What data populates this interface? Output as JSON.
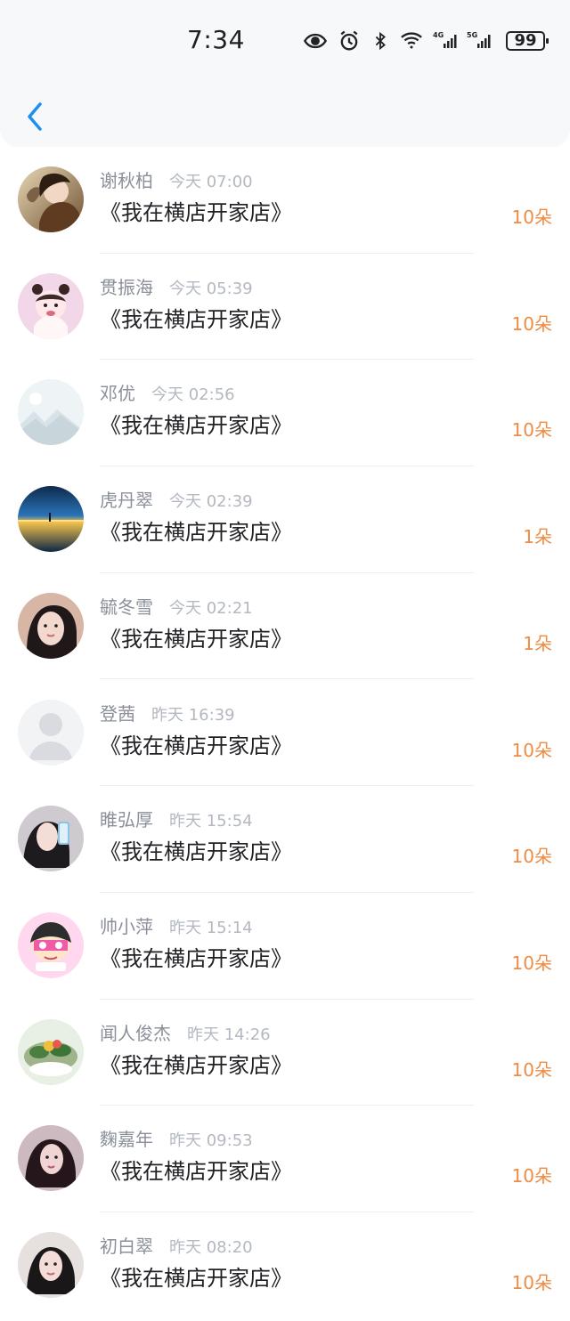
{
  "status_bar": {
    "time": "7:34",
    "battery": "99"
  },
  "list": [
    {
      "name": "谢秋柏",
      "time": "今天 07:00",
      "title": "《我在横店开家店》",
      "count": "10朵"
    },
    {
      "name": "贯振海",
      "time": "今天 05:39",
      "title": "《我在横店开家店》",
      "count": "10朵"
    },
    {
      "name": "邓优",
      "time": "今天 02:56",
      "title": "《我在横店开家店》",
      "count": "10朵"
    },
    {
      "name": "虎丹翠",
      "time": "今天 02:39",
      "title": "《我在横店开家店》",
      "count": "1朵"
    },
    {
      "name": "毓冬雪",
      "time": "今天 02:21",
      "title": "《我在横店开家店》",
      "count": "1朵"
    },
    {
      "name": "登茜",
      "time": "昨天 16:39",
      "title": "《我在横店开家店》",
      "count": "10朵"
    },
    {
      "name": "睢弘厚",
      "time": "昨天 15:54",
      "title": "《我在横店开家店》",
      "count": "10朵"
    },
    {
      "name": "帅小萍",
      "time": "昨天 15:14",
      "title": "《我在横店开家店》",
      "count": "10朵"
    },
    {
      "name": "闻人俊杰",
      "time": "昨天 14:26",
      "title": "《我在横店开家店》",
      "count": "10朵"
    },
    {
      "name": "麴嘉年",
      "time": "昨天 09:53",
      "title": "《我在横店开家店》",
      "count": "10朵"
    },
    {
      "name": "初白翠",
      "time": "昨天 08:20",
      "title": "《我在横店开家店》",
      "count": "10朵"
    }
  ],
  "colors": {
    "accent": "#1f8ef1",
    "count": "#ef8b43",
    "name": "#8a8f99",
    "time": "#b3b8c1",
    "title": "#202124"
  },
  "icons": [
    "eye-icon",
    "alarm-icon",
    "bluetooth-icon",
    "wifi-icon",
    "4g-signal-icon",
    "5g-signal-icon",
    "battery-icon",
    "back-chevron-icon"
  ]
}
